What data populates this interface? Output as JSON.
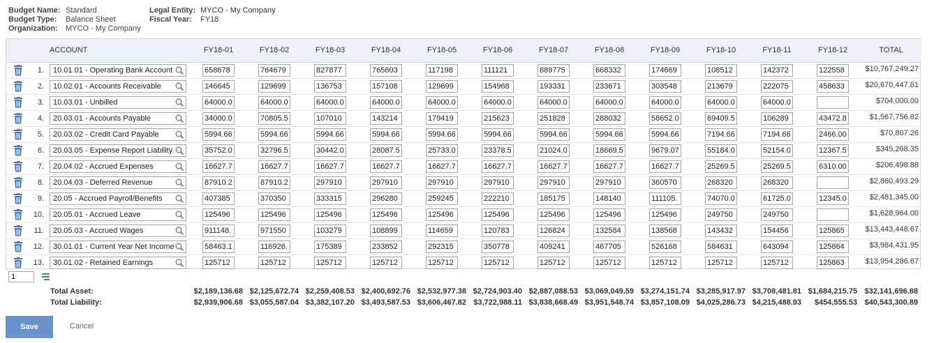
{
  "header": {
    "budget_name_label": "Budget Name:",
    "budget_name": "Standard",
    "budget_type_label": "Budget Type:",
    "budget_type": "Balance Sheet",
    "organization_label": "Organization:",
    "organization": "MYCO - My Company",
    "legal_entity_label": "Legal Entity:",
    "legal_entity": "MYCO - My Company",
    "fiscal_year_label": "Fiscal Year:",
    "fiscal_year": "FY18"
  },
  "columns": {
    "account": "ACCOUNT",
    "periods": [
      "FY18-01",
      "FY18-02",
      "FY18-03",
      "FY18-04",
      "FY18-05",
      "FY18-06",
      "FY18-07",
      "FY18-08",
      "FY18-09",
      "FY18-10",
      "FY18-11",
      "FY18-12"
    ],
    "total": "TOTAL"
  },
  "rows": [
    {
      "no": "1.",
      "account": "10.01.01 - Operating Bank Account",
      "values": [
        "658678",
        "764679",
        "827877",
        "765603",
        "117198",
        "111121",
        "889775",
        "668332",
        "174669",
        "108512",
        "142372",
        "122558"
      ],
      "total": "$10,767,249.27"
    },
    {
      "no": "2.",
      "account": "10.02.01 - Accounts Receivable",
      "values": [
        "146645",
        "129699",
        "136753",
        "157108",
        "129699",
        "154968",
        "193331",
        "233671",
        "303548",
        "213679",
        "222075",
        "458633"
      ],
      "total": "$20,670,447.61"
    },
    {
      "no": "3.",
      "account": "10.03.01 - Unbilled",
      "values": [
        "64000.0",
        "64000.0",
        "64000.0",
        "64000.0",
        "64000.0",
        "64000.0",
        "64000.0",
        "64000.0",
        "64000.0",
        "64000.0",
        "64000.0",
        ""
      ],
      "total": "$704,000.00"
    },
    {
      "no": "4.",
      "account": "20.03.01 - Accounts Payable",
      "values": [
        "34000.0",
        "70805.5",
        "107010",
        "143214",
        "179419",
        "215623",
        "251828",
        "288032",
        "58652.0",
        "69409.5",
        "106289",
        "43472.8"
      ],
      "total": "$1,567,756.82"
    },
    {
      "no": "5.",
      "account": "20.03.02 - Credit Card Payable",
      "values": [
        "5994.66",
        "5994.66",
        "5994.66",
        "5994.66",
        "5994.66",
        "5994.66",
        "5994.66",
        "5994.66",
        "5994.66",
        "7194.66",
        "7194.66",
        "2466.00"
      ],
      "total": "$70,807.26"
    },
    {
      "no": "6.",
      "account": "20.03.05 - Expense Report Liability",
      "values": [
        "35752.0",
        "32796.5",
        "30442.0",
        "28087.5",
        "25733.0",
        "23378.5",
        "21024.0",
        "18669.5",
        "9679.07",
        "55184.0",
        "52154.0",
        "12367.5"
      ],
      "total": "$345,268.35"
    },
    {
      "no": "7.",
      "account": "20.04.02 - Accrued Expenses",
      "values": [
        "16627.7",
        "16627.7",
        "16627.7",
        "16627.7",
        "16627.7",
        "16627.7",
        "16627.7",
        "16627.7",
        "16627.7",
        "25269.5",
        "25269.5",
        "6310.00"
      ],
      "total": "$206,498.88"
    },
    {
      "no": "8.",
      "account": "20.04.03 - Deferred Revenue",
      "values": [
        "87910.2",
        "87910.2",
        "297910",
        "297910",
        "297910",
        "297910",
        "297910",
        "297910",
        "360570",
        "268320",
        "268320",
        ""
      ],
      "total": "$2,860,493.29"
    },
    {
      "no": "9.",
      "account": "20.05 - Accrued Payroll/Benefits",
      "values": [
        "407385",
        "370350",
        "333315",
        "296280",
        "259245",
        "222210",
        "185175",
        "148140",
        "111105.",
        "74070.0",
        "61725.0",
        "12345.0"
      ],
      "total": "$2,481,345.00"
    },
    {
      "no": "10.",
      "account": "20.05.01 - Accrued Leave",
      "values": [
        "125496",
        "125496",
        "125496",
        "125496",
        "125496",
        "125496",
        "125496",
        "125496",
        "125496",
        "249750",
        "249750",
        ""
      ],
      "total": "$1,628,964.00"
    },
    {
      "no": "11.",
      "account": "20.05.03 - Accrued Wages",
      "values": [
        "911148.",
        "971550",
        "103279",
        "108899",
        "114659",
        "120783",
        "126824",
        "132584",
        "138568",
        "143432",
        "154456",
        "125865"
      ],
      "total": "$13,443,448.67"
    },
    {
      "no": "12.",
      "account": "30.01.01 - Current Year Net Income",
      "values": [
        "58463.1",
        "116926.",
        "175389",
        "233852",
        "292315",
        "350778",
        "409241",
        "467705",
        "526168",
        "584631",
        "643094",
        "125864"
      ],
      "total": "$3,984,431.95"
    },
    {
      "no": "13.",
      "account": "30.01.02 - Retained Earnings",
      "values": [
        "125712",
        "125712",
        "125712",
        "125712",
        "125712",
        "125712",
        "125712",
        "125712",
        "125712",
        "125712",
        "125712",
        "125863"
      ],
      "total": "$13,954,286.67"
    }
  ],
  "pager": {
    "page": "1"
  },
  "totals": {
    "asset_label": "Total Asset:",
    "asset": [
      "$2,189,136.68",
      "$2,125,672.74",
      "$2,259,408.53",
      "$2,400,692.76",
      "$2,532,977.38",
      "$2,724,903.40",
      "$2,887,088.53",
      "$3,069,049.59",
      "$3,274,151.74",
      "$3,285,917.97",
      "$3,708,481.81",
      "$1,684,215.75",
      "$32,141,696.88"
    ],
    "liability_label": "Total Liability:",
    "liability": [
      "$2,939,906.68",
      "$3,055,587.04",
      "$3,382,107.20",
      "$3,493,587.53",
      "$3,606,467.82",
      "$3,722,988.11",
      "$3,838,668.49",
      "$3,951,548.74",
      "$3,857,108.09",
      "$4,025,286.73",
      "$4,215,488.93",
      "$454,555.53",
      "$40,543,300.89"
    ]
  },
  "actions": {
    "save": "Save",
    "cancel": "Cancel"
  },
  "colors": {
    "header_bg": "#eef0fa",
    "save_bg": "#6b93c9",
    "trash": "#4a78b5"
  }
}
